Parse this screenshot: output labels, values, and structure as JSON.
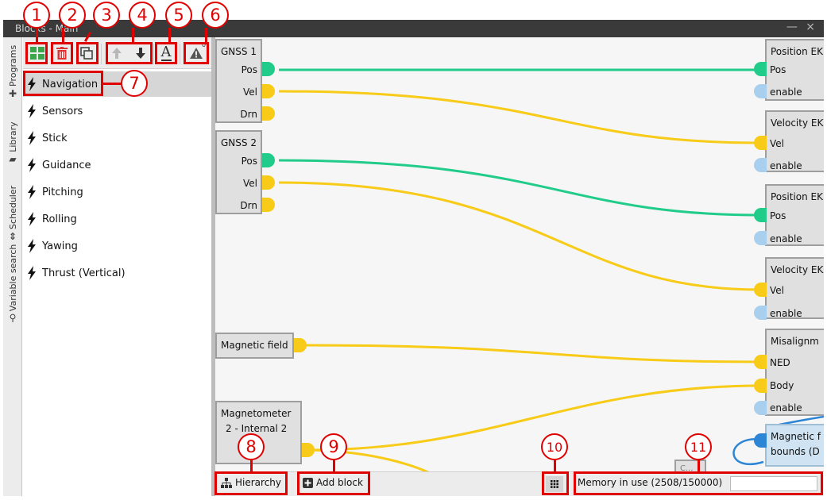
{
  "window": {
    "title": "Blocks - Main",
    "controls": "— ×"
  },
  "side_tabs": [
    {
      "label": "Programs",
      "icon": "plus-icon"
    },
    {
      "label": "Library",
      "icon": "folder-icon"
    },
    {
      "label": "Scheduler",
      "icon": "updown-icon"
    },
    {
      "label": "Variable search",
      "icon": "search-icon"
    }
  ],
  "toolbar": {
    "warning_count": "0",
    "text_button_label": "A",
    "icons": [
      "add-program-icon",
      "delete-icon",
      "duplicate-icon",
      "move-up-icon",
      "move-down-icon",
      "rename-icon",
      "warning-icon"
    ]
  },
  "programs": [
    {
      "label": "Navigation",
      "selected": true
    },
    {
      "label": "Sensors"
    },
    {
      "label": "Stick"
    },
    {
      "label": "Guidance"
    },
    {
      "label": "Pitching"
    },
    {
      "label": "Rolling"
    },
    {
      "label": "Yawing"
    },
    {
      "label": "Thrust (Vertical)"
    }
  ],
  "blocks": {
    "gnss1": {
      "title": "GNSS 1",
      "ports": [
        "Pos",
        "Vel",
        "Drn"
      ]
    },
    "gnss2": {
      "title": "GNSS 2",
      "ports": [
        "Pos",
        "Vel",
        "Drn"
      ]
    },
    "magfield": {
      "title": "Magnetic field"
    },
    "magnetometer": {
      "title": "Magnetometer",
      "title2": "2 - Internal 2"
    },
    "pos_ekf1": {
      "title": "Position EK",
      "ports": [
        "Pos",
        "enable"
      ]
    },
    "vel_ekf1": {
      "title": "Velocity EK",
      "ports": [
        "Vel",
        "enable"
      ]
    },
    "pos_ekf2": {
      "title": "Position EK",
      "ports": [
        "Pos",
        "enable"
      ]
    },
    "vel_ekf2": {
      "title": "Velocity EK",
      "ports": [
        "Vel",
        "enable"
      ]
    },
    "misalign": {
      "title": "Misalignm",
      "ports": [
        "NED",
        "Body",
        "enable"
      ]
    },
    "magbounds": {
      "title": "Magnetic f",
      "title2": "bounds (D"
    },
    "partial": {
      "title": "C..."
    }
  },
  "bottom": {
    "hierarchy_label": "Hierarchy",
    "add_block_label": "Add block",
    "memory_label": "Memory in use (2508/150000)"
  },
  "callouts": [
    "1",
    "2",
    "3",
    "4",
    "5",
    "6",
    "7",
    "8",
    "9",
    "10",
    "11"
  ],
  "colors": {
    "signal_yellow": "#f7cb17",
    "signal_green": "#21cc8a",
    "enable_blue": "#a9cfef",
    "annotation_red": "#e00000"
  }
}
